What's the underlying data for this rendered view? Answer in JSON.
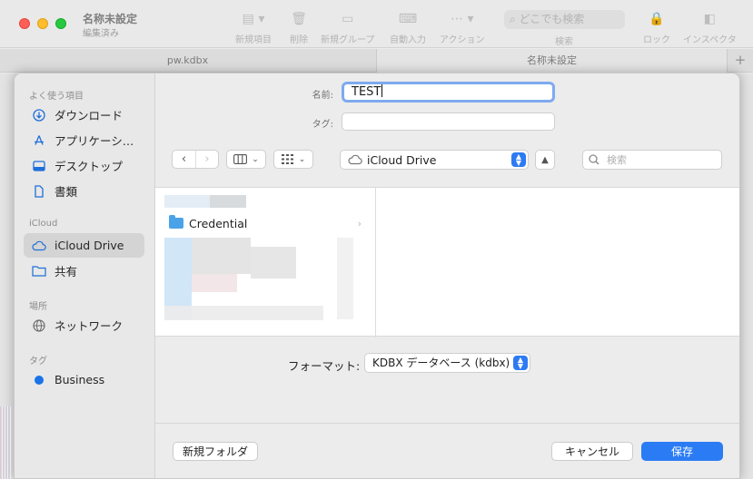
{
  "window": {
    "title": "名称未設定",
    "subtitle": "編集済み",
    "toolbar": [
      {
        "name": "new-entry",
        "label": "新規項目",
        "icon": "list-icon"
      },
      {
        "name": "delete",
        "label": "削除",
        "icon": "trash-icon"
      },
      {
        "name": "new-group",
        "label": "新規グループ",
        "icon": "folder-plus-icon"
      },
      {
        "name": "autotype",
        "label": "自動入力",
        "icon": "keyboard-icon"
      },
      {
        "name": "action",
        "label": "アクション",
        "icon": "ellipsis-icon"
      },
      {
        "name": "lock",
        "label": "ロック",
        "icon": "lock-icon"
      },
      {
        "name": "inspector",
        "label": "インスペクタ",
        "icon": "sidebar-icon"
      }
    ],
    "search_placeholder": "どこでも検索",
    "search_label": "検索",
    "tabs": [
      "pw.kdbx",
      "名称未設定"
    ],
    "tab_add": "+"
  },
  "sheet": {
    "sidebar": {
      "favorites_heading": "よく使う項目",
      "favorites": [
        {
          "label": "ダウンロード",
          "icon": "download-icon"
        },
        {
          "label": "アプリケーシ…",
          "icon": "applications-icon"
        },
        {
          "label": "デスクトップ",
          "icon": "desktop-icon"
        },
        {
          "label": "書類",
          "icon": "document-icon"
        }
      ],
      "icloud_heading": "iCloud",
      "icloud": [
        {
          "label": "iCloud Drive",
          "icon": "cloud-icon",
          "selected": true
        },
        {
          "label": "共有",
          "icon": "shared-folder-icon"
        }
      ],
      "locations_heading": "場所",
      "locations": [
        {
          "label": "ネットワーク",
          "icon": "globe-icon"
        }
      ],
      "tags_heading": "タグ",
      "tags": [
        {
          "label": "Business",
          "color": "#1a73e8"
        }
      ]
    },
    "name_label": "名前:",
    "name_value": "TEST",
    "tags_label": "タグ:",
    "location": "iCloud Drive",
    "search_placeholder": "検索",
    "folder": "Credential",
    "format_label": "フォーマット:",
    "format_value": "KDBX データベース (kdbx)",
    "new_folder_label": "新規フォルダ",
    "cancel_label": "キャンセル",
    "save_label": "保存",
    "accent": "#2b7cf4"
  }
}
